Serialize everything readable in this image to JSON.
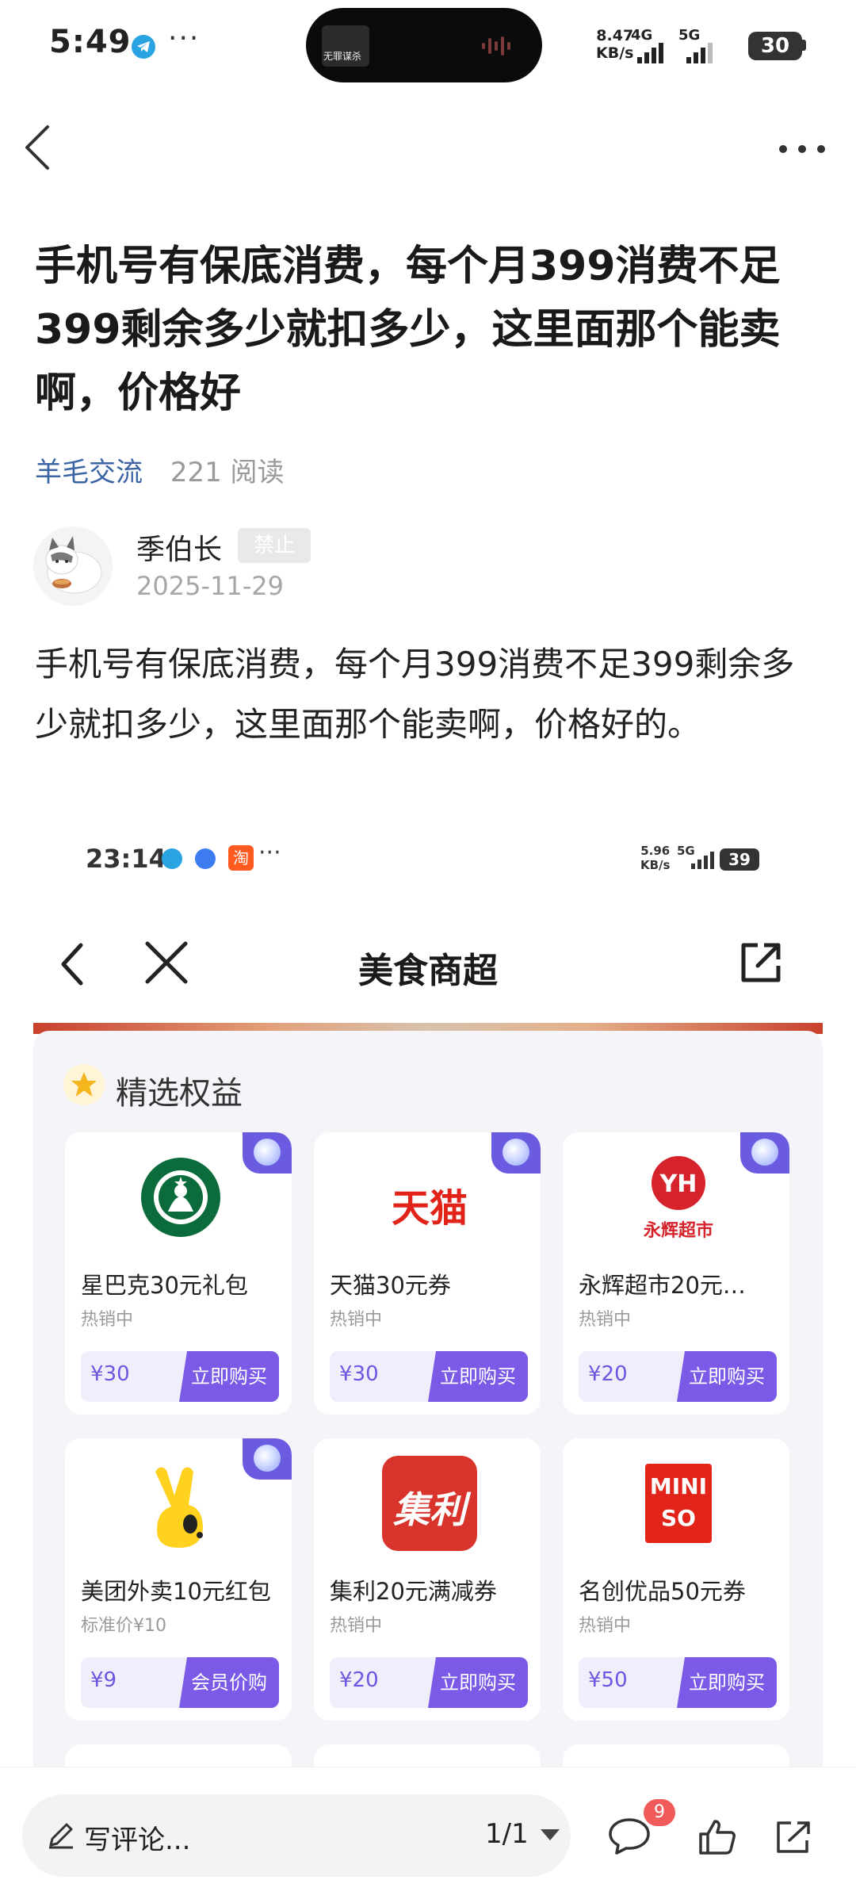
{
  "status_bar": {
    "time": "5:49",
    "speed_value": "8.47",
    "speed_unit": "KB/s",
    "net1": "4G",
    "net2": "5G",
    "battery": "30",
    "island_label": "无罪谋杀"
  },
  "post": {
    "title": "手机号有保底消费，每个月399消费不足399剩余多少就扣多少，这里面那个能卖啊，价格好",
    "board": "羊毛交流",
    "read_count": "221 阅读",
    "author": "季伯长",
    "author_badge": "禁止",
    "date": "2025-11-29",
    "body": "手机号有保底消费，每个月399消费不足399剩余多少就扣多少，这里面那个能卖啊，价格好的。"
  },
  "embedded_screenshot": {
    "status": {
      "time": "23:14",
      "app_icon_text": "淘",
      "speed_value": "5.96",
      "speed_unit": "KB/s",
      "net": "5G",
      "battery": "39"
    },
    "nav_title": "美食商超",
    "section_title": "精选权益",
    "cards": [
      {
        "name": "星巴克30元礼包",
        "sub": "热销中",
        "price": "¥30",
        "button": "立即购买",
        "logo": "starbucks-logo"
      },
      {
        "name": "天猫30元券",
        "sub": "热销中",
        "price": "¥30",
        "button": "立即购买",
        "logo": "tmall-logo",
        "logo_text": "天猫"
      },
      {
        "name": "永辉超市20元…",
        "sub": "热销中",
        "price": "¥20",
        "button": "立即购买",
        "logo": "yonghui-logo",
        "logo_text": "YH",
        "logo_caption": "永辉超市"
      },
      {
        "name": "美团外卖10元红包",
        "sub": "标准价¥10",
        "price": "¥9",
        "button": "会员价购",
        "logo": "meituan-logo"
      },
      {
        "name": "集利20元满减券",
        "sub": "热销中",
        "price": "¥20",
        "button": "立即购买",
        "logo": "jili-logo",
        "logo_text": "集利"
      },
      {
        "name": "名创优品50元券",
        "sub": "热销中",
        "price": "¥50",
        "button": "立即购买",
        "logo": "miniso-logo",
        "logo_text_top": "MINI",
        "logo_text_bottom": "SO"
      }
    ],
    "colors": {
      "accent": "#7a5ae6",
      "price": "#6b57e0",
      "corner": "#6b5be0"
    }
  },
  "bottom_bar": {
    "comment_placeholder": "写评论...",
    "page_indicator": "1/1",
    "comment_count": "9"
  },
  "colors": {
    "board_link": "#3b64a5",
    "muted": "#9a9a9a",
    "badge_red": "#f05a5a"
  }
}
